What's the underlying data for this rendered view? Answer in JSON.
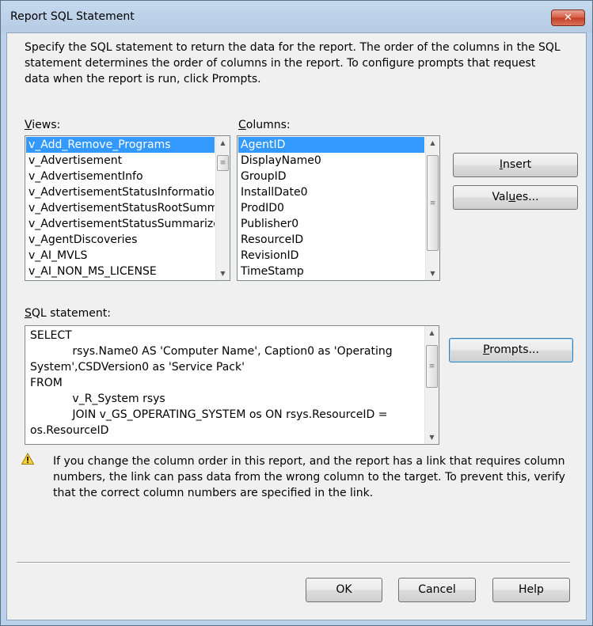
{
  "window": {
    "title": "Report SQL Statement",
    "close_glyph": "✕"
  },
  "description": "Specify the SQL statement to return the data for the report. The order of the columns in the SQL statement determines the order of columns in the report. To configure prompts that request data when the report is run, click Prompts.",
  "views": {
    "label_accel": "V",
    "label_rest": "iews:",
    "items": [
      "v_Add_Remove_Programs",
      "v_Advertisement",
      "v_AdvertisementInfo",
      "v_AdvertisementStatusInformation",
      "v_AdvertisementStatusRootSumm",
      "v_AdvertisementStatusSummarize",
      "v_AgentDiscoveries",
      "v_AI_MVLS",
      "v_AI_NON_MS_LICENSE"
    ],
    "selected": "v_Add_Remove_Programs"
  },
  "columns": {
    "label_accel": "C",
    "label_rest": "olumns:",
    "items": [
      "AgentID",
      "DisplayName0",
      "GroupID",
      "InstallDate0",
      "ProdID0",
      "Publisher0",
      "ResourceID",
      "RevisionID",
      "TimeStamp"
    ],
    "selected": "AgentID"
  },
  "buttons": {
    "insert_accel": "I",
    "insert_rest": "nsert",
    "values_pre": "Val",
    "values_accel": "u",
    "values_post": "es...",
    "prompts_accel": "P",
    "prompts_rest": "rompts...",
    "ok": "OK",
    "cancel": "Cancel",
    "help": "Help"
  },
  "sql": {
    "label_accel": "S",
    "label_rest": "QL statement:",
    "text": "SELECT\n\t    rsys.Name0 AS 'Computer Name', Caption0 as 'Operating System',CSDVersion0 as 'Service Pack'\nFROM\n\t    v_R_System rsys\n\t    JOIN v_GS_OPERATING_SYSTEM os ON rsys.ResourceID = os.ResourceID"
  },
  "warning": {
    "icon": "warning-triangle",
    "text": "If you change the column order in this report, and the report has a link that requires column numbers, the link can pass data from the wrong column to the target. To prevent this, verify that the correct column numbers are specified in the link."
  }
}
